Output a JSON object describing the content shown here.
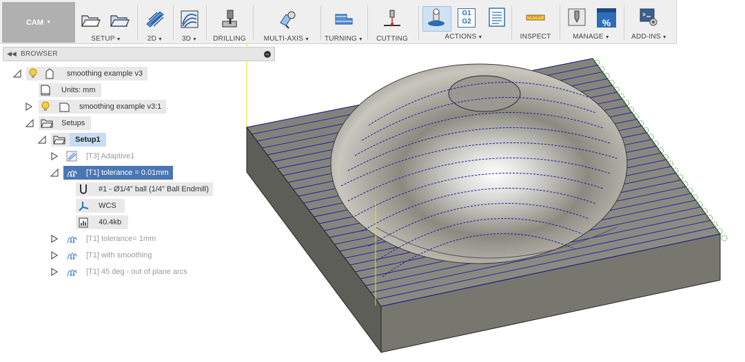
{
  "toolbar": {
    "workspace": "CAM",
    "groups": [
      {
        "label": "SETUP",
        "has_menu": true
      },
      {
        "label": "2D",
        "has_menu": true
      },
      {
        "label": "3D",
        "has_menu": true
      },
      {
        "label": "DRILLING",
        "has_menu": false
      },
      {
        "label": "MULTI-AXIS",
        "has_menu": true
      },
      {
        "label": "TURNING",
        "has_menu": true
      },
      {
        "label": "CUTTING",
        "has_menu": false
      },
      {
        "label": "ACTIONS",
        "has_menu": true
      },
      {
        "label": "INSPECT",
        "has_menu": false
      },
      {
        "label": "MANAGE",
        "has_menu": true
      },
      {
        "label": "ADD-INS",
        "has_menu": true
      }
    ],
    "g1g2_text": "G1 G2"
  },
  "browser": {
    "title": "BROWSER",
    "document": "smoothing example v3",
    "units": "Units: mm",
    "component": "smoothing example v3:1",
    "setups": "Setups",
    "setup1": "Setup1",
    "ops": {
      "adaptive": "[T3] Adaptive1",
      "tol001": "[T1] tolerance = 0.01mm",
      "tool": "#1 - Ø1/4\" ball (1/4\" Ball Endmill)",
      "wcs": "WCS",
      "size": "40.4kb",
      "tol1": "[T1] tolerance= 1mm",
      "smoothing": "[T1] with smoothing",
      "deg45": "[T1] 45 deg - out of plane arcs"
    }
  },
  "colors": {
    "toolpath": "#1a1aa8",
    "stock_top": "#8a8a83",
    "stock_side": "#6e6e68",
    "selection": "#4a77b4",
    "axis_line": "#e6e600"
  }
}
